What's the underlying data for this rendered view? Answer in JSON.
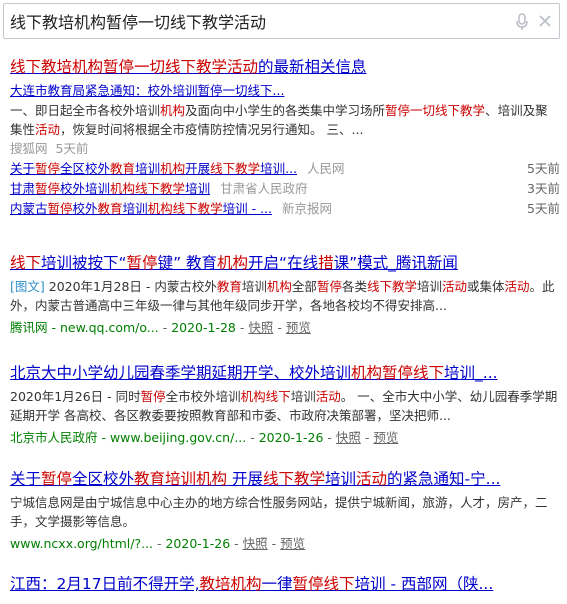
{
  "search": {
    "value": "线下教培机构暂停一切线下教学活动"
  },
  "results": [
    {
      "title_parts": [
        {
          "text": "线下教培机构暂停一切线下教学活动",
          "hl": true
        },
        {
          "text": "的最新相关信息",
          "hl": false
        }
      ],
      "top_title": "大连市教育局紧急通知：校外培训暂停一切线下...",
      "snippet_parts": [
        {
          "text": "一、即日起全市各校外培训",
          "hl": false
        },
        {
          "text": "机构",
          "hl": true
        },
        {
          "text": "及面向中小学生的各类集中学习场所",
          "hl": false
        },
        {
          "text": "暂停一切线下教学",
          "hl": true
        },
        {
          "text": "、培训及聚集性",
          "hl": false
        },
        {
          "text": "活动",
          "hl": true
        },
        {
          "text": "，恢复时间将根据全市疫情防控情况另行通知。 三、...",
          "hl": false
        }
      ],
      "source": "搜狐网",
      "time": "5天前",
      "subs": [
        {
          "parts": [
            {
              "text": "关于",
              "hl": false
            },
            {
              "text": "暂停",
              "hl": true
            },
            {
              "text": "全区校外",
              "hl": false
            },
            {
              "text": "教育",
              "hl": true
            },
            {
              "text": "培训",
              "hl": false
            },
            {
              "text": "机构",
              "hl": true
            },
            {
              "text": "开展",
              "hl": false
            },
            {
              "text": "线下教学",
              "hl": true
            },
            {
              "text": "培训...",
              "hl": false
            }
          ],
          "source": "人民网",
          "date": "5天前"
        },
        {
          "parts": [
            {
              "text": "甘肃",
              "hl": false
            },
            {
              "text": "暂停",
              "hl": true
            },
            {
              "text": "校外培训",
              "hl": false
            },
            {
              "text": "机构线下教学",
              "hl": true
            },
            {
              "text": "培训",
              "hl": false
            }
          ],
          "source": "甘肃省人民政府",
          "date": "3天前"
        },
        {
          "parts": [
            {
              "text": "内蒙古",
              "hl": false
            },
            {
              "text": "暂停",
              "hl": true
            },
            {
              "text": "校外",
              "hl": false
            },
            {
              "text": "教育",
              "hl": true
            },
            {
              "text": "培训",
              "hl": false
            },
            {
              "text": "机构线下教学",
              "hl": true
            },
            {
              "text": "培训 - ...",
              "hl": false
            }
          ],
          "source": "新京报网",
          "date": "5天前"
        }
      ]
    },
    {
      "title_parts": [
        {
          "text": "线下",
          "hl": true
        },
        {
          "text": "培训被按下“",
          "hl": false
        },
        {
          "text": "暂停",
          "hl": true
        },
        {
          "text": "键” 教育",
          "hl": false
        },
        {
          "text": "机构",
          "hl": true
        },
        {
          "text": "开启“在线",
          "hl": false
        },
        {
          "text": "措",
          "hl": true
        },
        {
          "text": "课”模式_腾讯新闻",
          "hl": false
        }
      ],
      "snippet_parts": [
        {
          "text": "[图文]",
          "tag": true
        },
        {
          "text": " 2020年1月28日 - 内蒙古校外",
          "hl": false
        },
        {
          "text": "教育",
          "hl": true
        },
        {
          "text": "培训",
          "hl": false
        },
        {
          "text": "机构",
          "hl": true
        },
        {
          "text": "全部",
          "hl": false
        },
        {
          "text": "暂停",
          "hl": true
        },
        {
          "text": "各类",
          "hl": false
        },
        {
          "text": "线下教学",
          "hl": true
        },
        {
          "text": "培训",
          "hl": false
        },
        {
          "text": "活动",
          "hl": true
        },
        {
          "text": "或集体",
          "hl": false
        },
        {
          "text": "活动",
          "hl": true
        },
        {
          "text": "。此外，内蒙古普通高中三年级一律与其他年级同步开学，各地各校均不得安排高...",
          "hl": false
        }
      ],
      "url": "腾讯网 - new.qq.com/o...",
      "date": "2020-1-28",
      "snapshot": "快照",
      "preview": "预览"
    },
    {
      "title_parts": [
        {
          "text": "北京大中小学幼儿园春季学期延期开学、校外培训",
          "hl": false
        },
        {
          "text": "机构暂停线下",
          "hl": true
        },
        {
          "text": "培训_...",
          "hl": false
        }
      ],
      "snippet_parts": [
        {
          "text": "2020年1月26日 - 同时",
          "hl": false
        },
        {
          "text": "暂停",
          "hl": true
        },
        {
          "text": "全市校外培训",
          "hl": false
        },
        {
          "text": "机构线下",
          "hl": true
        },
        {
          "text": "培训",
          "hl": false
        },
        {
          "text": "活动",
          "hl": true
        },
        {
          "text": "。 一、全市大中小学、幼儿园春季学期延期开学 各高校、各区教委要按照教育部和市委、市政府决策部署，坚决把师...",
          "hl": false
        }
      ],
      "url": "北京市人民政府 - www.beijing.gov.cn/...",
      "date": "2020-1-26",
      "snapshot": "快照",
      "preview": "预览"
    },
    {
      "title_parts": [
        {
          "text": "关于",
          "hl": false
        },
        {
          "text": "暂停",
          "hl": true
        },
        {
          "text": "全区校外",
          "hl": false
        },
        {
          "text": "教育培训机构",
          "hl": true
        },
        {
          "text": " 开展",
          "hl": false
        },
        {
          "text": "线下教学",
          "hl": true
        },
        {
          "text": "培训",
          "hl": false
        },
        {
          "text": "活动",
          "hl": true
        },
        {
          "text": "的紧急通知-宁...",
          "hl": false
        }
      ],
      "snippet_parts": [
        {
          "text": "宁城信息网是由宁城信息中心主办的地方综合性服务网站，提供宁城新闻，旅游，人才，房产，二手，文学摄影等信息。",
          "hl": false
        }
      ],
      "url": "www.ncxx.org/html/?...",
      "date": "2020-1-26",
      "snapshot": "快照",
      "preview": "预览"
    },
    {
      "title_parts": [
        {
          "text": "江西：2月17日前不得开学,",
          "hl": false
        },
        {
          "text": "教培机构",
          "hl": true
        },
        {
          "text": "一律",
          "hl": false
        },
        {
          "text": "暂停线下",
          "hl": true
        },
        {
          "text": "培训 - 西部网（陕...",
          "hl": false
        }
      ]
    }
  ]
}
